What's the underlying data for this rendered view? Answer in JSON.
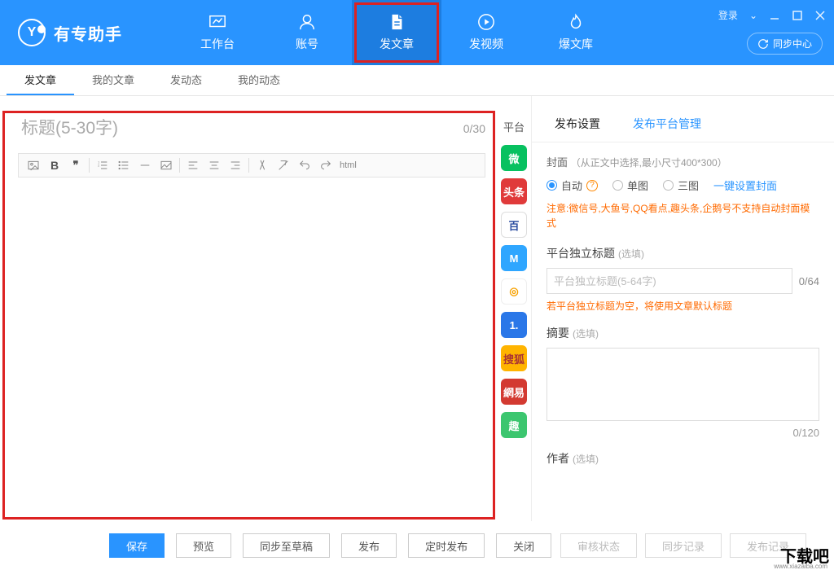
{
  "app": {
    "title": "有专助手"
  },
  "window": {
    "login": "登录",
    "dropdown_glyph": "⌄"
  },
  "sync_center": "同步中心",
  "topnav": [
    {
      "label": "工作台"
    },
    {
      "label": "账号"
    },
    {
      "label": "发文章"
    },
    {
      "label": "发视频"
    },
    {
      "label": "爆文库"
    }
  ],
  "subtabs": [
    {
      "label": "发文章"
    },
    {
      "label": "我的文章"
    },
    {
      "label": "发动态"
    },
    {
      "label": "我的动态"
    }
  ],
  "editor": {
    "title_placeholder": "标题(5-30字)",
    "title_count": "0/30",
    "toolbar_html": "html"
  },
  "platform_header": "平台",
  "platforms": [
    {
      "text": "微",
      "bg": "#07c160"
    },
    {
      "text": "头条",
      "bg": "#e03a3a"
    },
    {
      "text": "百",
      "bg": "#ffffff",
      "fg": "#2b4da0",
      "border": "1px solid #ddd"
    },
    {
      "text": "M",
      "bg": "#2fa6ff"
    },
    {
      "text": "◎",
      "bg": "#ffffff",
      "fg": "#f7a100",
      "border": "1px solid #eee"
    },
    {
      "text": "1.",
      "bg": "#2a77e8"
    },
    {
      "text": "搜狐",
      "bg": "#ffb400",
      "fg": "#a33"
    },
    {
      "text": "網易",
      "bg": "#d33a31"
    },
    {
      "text": "趣",
      "bg": "#3cc66f"
    }
  ],
  "settings": {
    "tabs": {
      "publish": "发布设置",
      "manage": "发布平台管理"
    },
    "cover_label": "封面",
    "cover_hint": "（从正文中选择,最小尺寸400*300）",
    "radios": {
      "auto": "自动",
      "single": "单图",
      "triple": "三图"
    },
    "one_click": "一键设置封面",
    "warn": "注意:微信号,大鱼号,QQ看点,趣头条,企鹅号不支持自动封面模式",
    "plat_title_label": "平台独立标题",
    "optional": "(选填)",
    "plat_title_placeholder": "平台独立标题(5-64字)",
    "plat_title_count": "0/64",
    "plat_title_warn": "若平台独立标题为空，将使用文章默认标题",
    "summary_label": "摘要",
    "summary_count": "0/120",
    "author_label": "作者"
  },
  "bottom": {
    "save": "保存",
    "preview": "预览",
    "sync_draft": "同步至草稿",
    "publish": "发布",
    "timed_publish": "定时发布",
    "close": "关闭",
    "audit_status": "审核状态",
    "sync_log": "同步记录",
    "publish_log": "发布记录"
  },
  "watermark": {
    "big": "下载吧",
    "url": "www.xiazaiba.com"
  }
}
